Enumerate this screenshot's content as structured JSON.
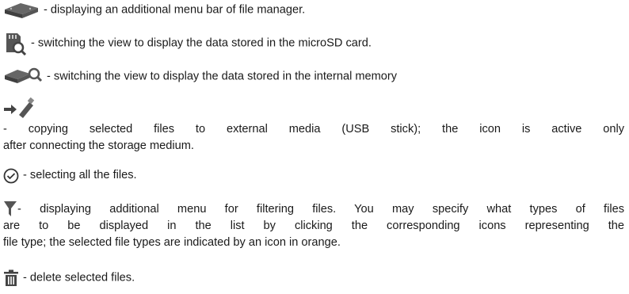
{
  "items": [
    {
      "icon": "hdd-stack-icon",
      "text": "- displaying an additional menu bar of file manager."
    },
    {
      "icon": "sd-card-search-icon",
      "text": "- switching the view to display the data stored in the microSD card."
    },
    {
      "icon": "hdd-stack-search-icon",
      "text": "- switching the view to display the data stored in the internal memory"
    },
    {
      "icon": "arrow-usb-stick-icon",
      "line1": "- copying selected files to external media (USB stick); the icon is active only",
      "line2": "after connecting the storage medium."
    },
    {
      "icon": "check-circle-icon",
      "text": "- selecting all the files."
    },
    {
      "icon": "funnel-icon",
      "line1": "- displaying additional menu for filtering files. You may specify what types of files",
      "line2": "are to be displayed in the list by clicking the corresponding icons representing the",
      "line3": "file type; the selected file types are indicated by an icon in orange."
    },
    {
      "icon": "trash-icon",
      "text": "- delete selected files."
    }
  ]
}
